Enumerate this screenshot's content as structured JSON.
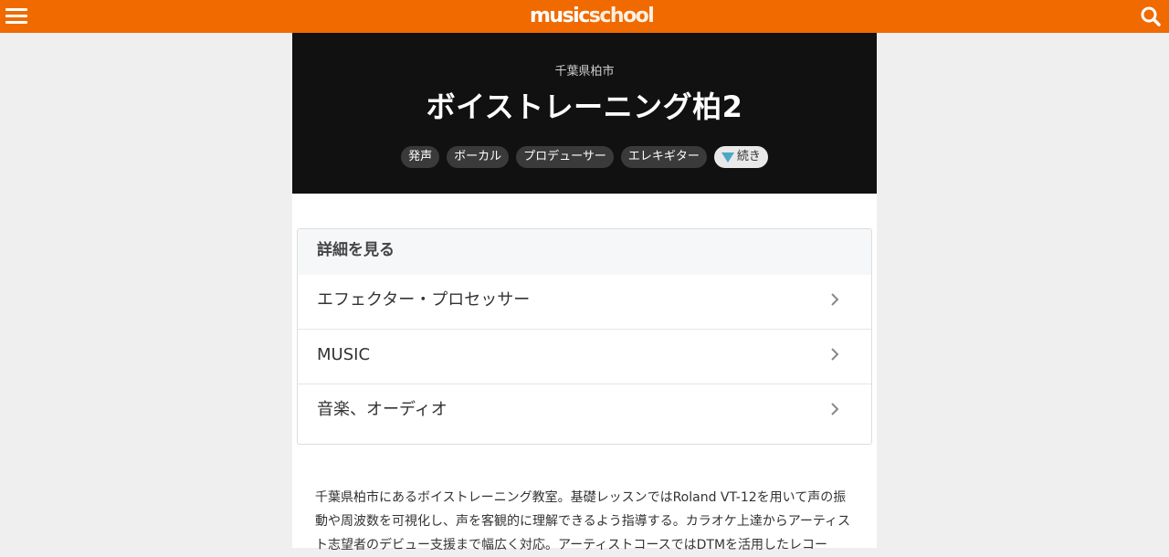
{
  "header": {
    "logo_part1": "music",
    "logo_part2": "school",
    "colors": {
      "bar": "#f06a00"
    },
    "icons": {
      "menu": "hamburger-menu-icon",
      "search": "search-icon"
    }
  },
  "hero": {
    "location": "千葉県柏市",
    "title": "ボイストレーニング柏2",
    "tags": [
      "発声",
      "ボーカル",
      "プロデューサー",
      "エレキギター"
    ],
    "more_label": "続き"
  },
  "details": {
    "heading": "詳細を見る",
    "items": [
      {
        "label": "エフェクター・プロセッサー"
      },
      {
        "label": "MUSIC"
      },
      {
        "label": "音楽、オーディオ"
      }
    ]
  },
  "description": "千葉県柏市にあるボイストレーニング教室。基礎レッスンではRoland VT-12を用いて声の振動や周波数を可視化し、声を客観的に理解できるよう指導する。カラオケ上達からアーティスト志望者のデビュー支援まで幅広く対応。アーティストコースではDTMを活用したレコー"
}
